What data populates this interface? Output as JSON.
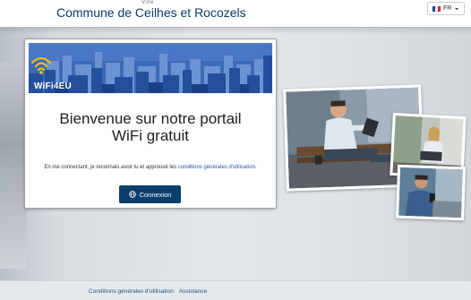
{
  "header": {
    "ville": "Ville",
    "commune": "Commune de Ceilhes et Rocozels",
    "language": {
      "selected": "FR",
      "flag_colors": [
        "#1f3f99",
        "#ffffff",
        "#d52b1e"
      ]
    }
  },
  "card": {
    "logo_text": "WiFi4EU",
    "welcome_line1": "Bienvenue sur notre portail",
    "welcome_line2": "WiFi gratuit",
    "legal_prefix": "En me connectant, je reconnais avoir lu et approuvé les ",
    "legal_link": "conditions générales d'utilisation",
    "legal_suffix": ".",
    "connect_label": "Connexion"
  },
  "photos": [
    {
      "name": "man-on-bench-with-tablet-photo"
    },
    {
      "name": "woman-with-laptop-photo"
    },
    {
      "name": "man-with-phone-photo"
    }
  ],
  "footer": {
    "terms_link": "Conditions générales d'utilisation",
    "help_link": "Assistance"
  },
  "colors": {
    "brand_blue": "#0d3f6e",
    "title_blue": "#0b3a6b",
    "banner_blue": "#3b67b5",
    "link_blue": "#1a5aa8"
  }
}
